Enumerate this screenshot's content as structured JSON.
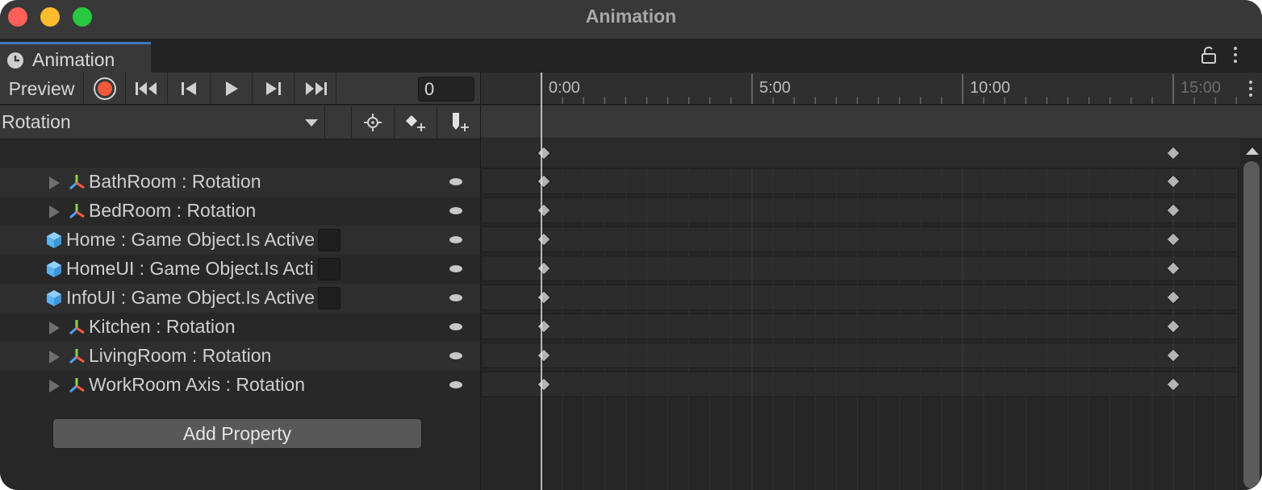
{
  "window": {
    "title": "Animation"
  },
  "tab": {
    "label": "Animation"
  },
  "toolbar": {
    "preview_label": "Preview",
    "frame_value": "0"
  },
  "clip_selector": {
    "selected": "Rotation"
  },
  "timeline": {
    "labels": [
      "0:00",
      "5:00",
      "10:00",
      "15:00"
    ]
  },
  "properties": [
    {
      "label": "BathRoom : Rotation",
      "kind": "rotation"
    },
    {
      "label": "BedRoom : Rotation",
      "kind": "rotation"
    },
    {
      "label": "Home : Game Object.Is Active",
      "kind": "gameobject"
    },
    {
      "label": "HomeUI : Game Object.Is Active",
      "kind": "gameobject"
    },
    {
      "label": "InfoUI : Game Object.Is Active",
      "kind": "gameobject"
    },
    {
      "label": "Kitchen : Rotation",
      "kind": "rotation"
    },
    {
      "label": "LivingRoom : Rotation",
      "kind": "rotation"
    },
    {
      "label": "WorkRoom Axis : Rotation",
      "kind": "rotation"
    }
  ],
  "add_property_label": "Add Property",
  "colors": {
    "record": "#f15a3a",
    "tab_accent": "#3a79bb",
    "cube": "#5ab4f0"
  }
}
